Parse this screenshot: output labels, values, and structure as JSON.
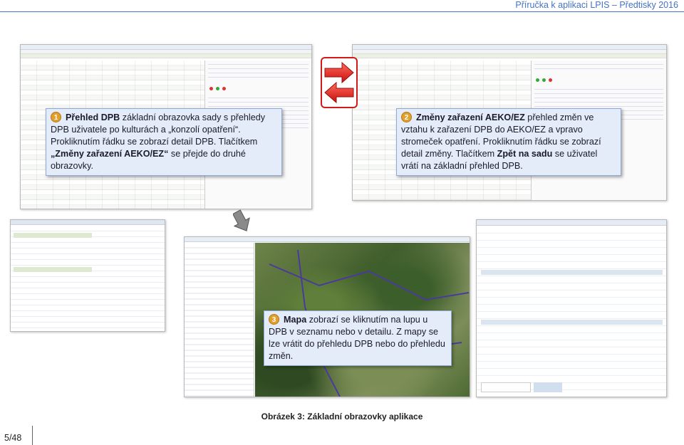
{
  "header": {
    "title": "Příručka k aplikaci LPIS – Předtisky 2016"
  },
  "callouts": [
    {
      "number": "1",
      "bold": "Přehled DPB",
      "text": " základní obrazovka sady s přehledy DPB uživatele po kulturách a „konzolí opatření“. Prokliknutím řádku se zobrazí detail DPB. Tlačítkem ",
      "bold2": "„Změny zařazení AEKO/EZ“",
      "text2": " se přejde do druhé obrazovky."
    },
    {
      "number": "2",
      "bold": "Změny zařazení AEKO/EZ",
      "text": " přehled změn ve vztahu k zařazení DPB do AEKO/EZ a vpravo stromeček opatření. Prokliknutím řádku se zobrazí detail změny. Tlačítkem ",
      "bold2": "Zpět na sadu",
      "text2": " se uživatel vrátí na základní přehled DPB."
    },
    {
      "number": "3",
      "bold": "Mapa",
      "text": " zobrazí se kliknutím na lupu u DPB v seznamu nebo v detailu. Z mapy se lze vrátit do přehledu DPB nebo do přehledu změn.",
      "bold2": "",
      "text2": ""
    }
  ],
  "caption": "Obrázek 3: Základní obrazovky aplikace",
  "page_number": "5/48",
  "colors": {
    "accent": "#4472c4",
    "callout_bg": "#e3ecf8",
    "badge": "#e2a02a",
    "arrow": "#d21a1a"
  },
  "icons": {
    "arrow_right": "arrow-right-icon",
    "arrow_left": "arrow-left-icon",
    "arrow_down": "arrow-down-icon"
  }
}
